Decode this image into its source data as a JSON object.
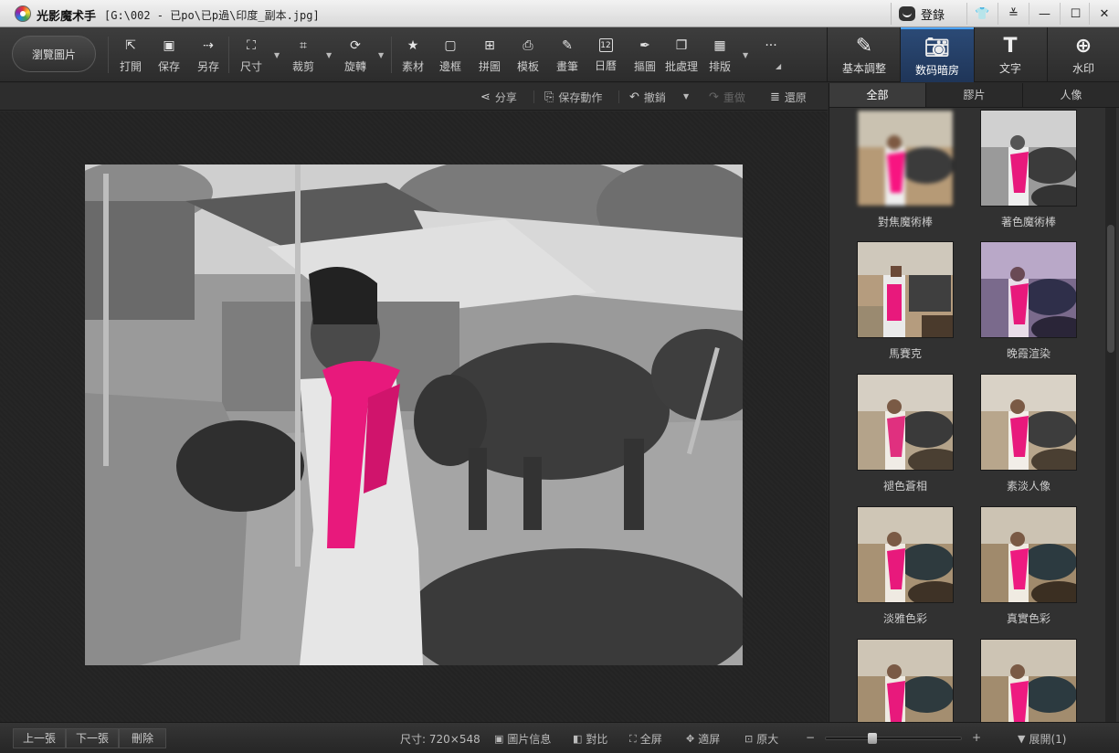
{
  "titlebar": {
    "app_title": "光影魔术手",
    "file_path": "[G:\\002 - 已po\\已p過\\印度_副本.jpg]",
    "login_label": "登錄"
  },
  "toolbar": {
    "browse_label": "瀏覽圖片",
    "tools": [
      {
        "label": "打開",
        "icon": "open-icon"
      },
      {
        "label": "保存",
        "icon": "save-icon"
      },
      {
        "label": "另存",
        "icon": "save-as-icon"
      },
      {
        "label": "尺寸",
        "icon": "resize-icon"
      },
      {
        "label": "裁剪",
        "icon": "crop-icon"
      },
      {
        "label": "旋轉",
        "icon": "rotate-icon"
      },
      {
        "label": "素材",
        "icon": "material-icon"
      },
      {
        "label": "邊框",
        "icon": "border-icon"
      },
      {
        "label": "拼圖",
        "icon": "collage-icon"
      },
      {
        "label": "模板",
        "icon": "template-icon"
      },
      {
        "label": "畫筆",
        "icon": "brush-icon"
      },
      {
        "label": "日曆",
        "icon": "calendar-icon"
      },
      {
        "label": "摳圖",
        "icon": "cutout-icon"
      },
      {
        "label": "批處理",
        "icon": "batch-icon"
      },
      {
        "label": "排版",
        "icon": "layout-icon"
      }
    ],
    "calendar_day": "12",
    "more_label": "···",
    "modes": [
      {
        "label": "基本調整",
        "icon": "basic-adjust-icon"
      },
      {
        "label": "数码暗房",
        "icon": "darkroom-camera-icon"
      },
      {
        "label": "文字",
        "icon": "text-icon"
      },
      {
        "label": "水印",
        "icon": "watermark-icon"
      }
    ]
  },
  "actionbar": {
    "share": "分享",
    "save_action": "保存動作",
    "undo": "撤銷",
    "redo": "重做",
    "restore": "還原"
  },
  "right_panel": {
    "tabs": [
      "全部",
      "膠片",
      "人像"
    ],
    "active_tab": "全部",
    "effects": [
      {
        "label": "對焦魔術棒"
      },
      {
        "label": "著色魔術棒"
      },
      {
        "label": "馬賽克"
      },
      {
        "label": "晚霞渲染"
      },
      {
        "label": "褪色蒼相"
      },
      {
        "label": "素淡人像"
      },
      {
        "label": "淡雅色彩"
      },
      {
        "label": "真實色彩"
      },
      {
        "label": ""
      },
      {
        "label": ""
      }
    ]
  },
  "statusbar": {
    "prev": "上一張",
    "next": "下一張",
    "delete": "刪除",
    "size_text": "尺寸: 720×548",
    "image_info": "圖片信息",
    "compare": "對比",
    "fullscreen": "全屏",
    "fit": "適屏",
    "original": "原大",
    "zoom_minus": "−",
    "zoom_plus": "+",
    "expand": "展開(1)",
    "zoom_fraction": 0.33
  },
  "colors": {
    "accent": "#2b4a76",
    "scarf": "#e8197c"
  }
}
